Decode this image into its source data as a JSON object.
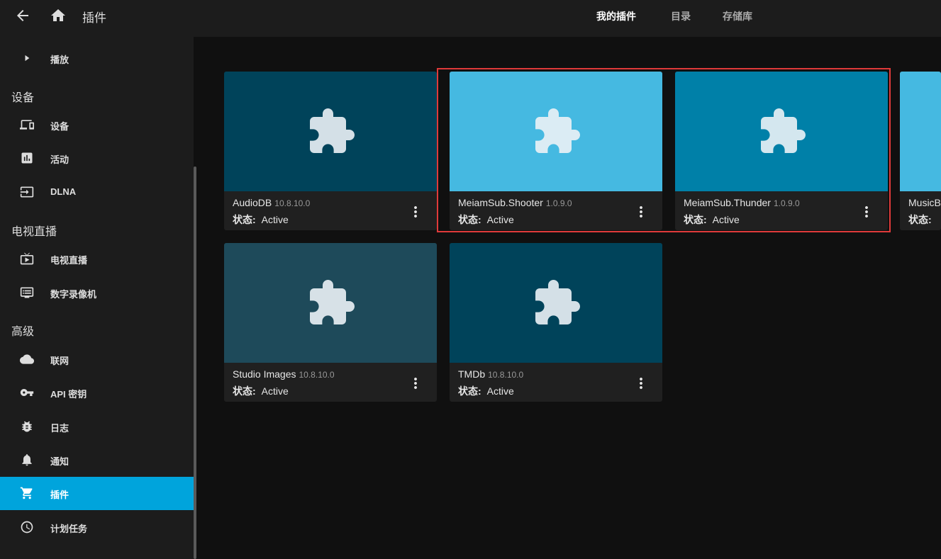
{
  "header": {
    "title": "插件",
    "tabs": [
      {
        "label": "我的插件",
        "active": true
      },
      {
        "label": "目录",
        "active": false
      },
      {
        "label": "存储库",
        "active": false
      }
    ]
  },
  "sidebar": {
    "items": [
      {
        "label": "播放",
        "icon": "play-icon"
      },
      {
        "section": "设备"
      },
      {
        "label": "设备",
        "icon": "devices-icon"
      },
      {
        "label": "活动",
        "icon": "activity-icon"
      },
      {
        "label": "DLNA",
        "icon": "input-icon"
      },
      {
        "section": "电视直播"
      },
      {
        "label": "电视直播",
        "icon": "live-tv-icon"
      },
      {
        "label": "数字录像机",
        "icon": "dvr-icon"
      },
      {
        "section": "高级"
      },
      {
        "label": "联网",
        "icon": "cloud-icon"
      },
      {
        "label": "API 密钥",
        "icon": "key-icon"
      },
      {
        "label": "日志",
        "icon": "bug-icon"
      },
      {
        "label": "通知",
        "icon": "bell-icon"
      },
      {
        "label": "插件",
        "icon": "cart-icon",
        "active": true
      },
      {
        "label": "计划任务",
        "icon": "clock-icon"
      }
    ]
  },
  "plugins": [
    {
      "name": "AudioDB",
      "version": "10.8.10.0",
      "status_label": "状态:",
      "status": "Active",
      "color": "#00435a"
    },
    {
      "name": "MeiamSub.Shooter",
      "version": "1.0.9.0",
      "status_label": "状态:",
      "status": "Active",
      "color": "#45b9e1"
    },
    {
      "name": "MeiamSub.Thunder",
      "version": "1.0.9.0",
      "status_label": "状态:",
      "status": "Active",
      "color": "#0080a8"
    },
    {
      "name": "MusicB",
      "version": "",
      "status_label": "状态:",
      "status": "",
      "color": "#45b9e1"
    },
    {
      "name": "Studio Images",
      "version": "10.8.10.0",
      "status_label": "状态:",
      "status": "Active",
      "color": "#1e4a5a"
    },
    {
      "name": "TMDb",
      "version": "10.8.10.0",
      "status_label": "状态:",
      "status": "Active",
      "color": "#00435a"
    }
  ],
  "colors": {
    "accent": "#00a4dc",
    "highlight_border": "#e03a3a"
  }
}
